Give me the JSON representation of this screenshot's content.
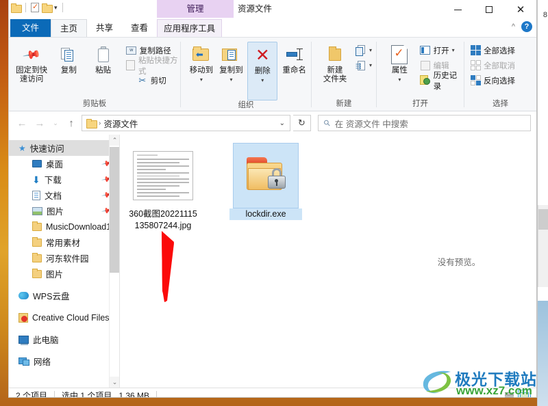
{
  "window": {
    "title": "资源文件",
    "contextual_tab_band": "管理",
    "quick_access": [
      {
        "name": "folder-icon",
        "label": "资源管理器"
      },
      {
        "name": "properties-icon",
        "label": "属性"
      },
      {
        "name": "new-folder-icon",
        "label": "新建文件夹"
      },
      {
        "name": "customize-caret",
        "label": "自定义快速访问工具栏"
      }
    ],
    "controls": {
      "minimize": "—",
      "maximize": "□",
      "close": "✕"
    },
    "ribbon_collapse": "^",
    "help": "?"
  },
  "tabs": [
    {
      "label": "文件",
      "state": "file"
    },
    {
      "label": "主页",
      "state": "active"
    },
    {
      "label": "共享",
      "state": "normal"
    },
    {
      "label": "查看",
      "state": "normal"
    },
    {
      "label": "应用程序工具",
      "state": "contextual"
    }
  ],
  "ribbon": {
    "groups": [
      {
        "label": "剪贴板",
        "big_buttons": [
          {
            "label": "固定到快\n速访问",
            "icon": "pin-icon"
          },
          {
            "label": "复制",
            "icon": "copy-icon"
          },
          {
            "label": "粘贴",
            "icon": "paste-icon"
          }
        ],
        "small_buttons": [
          {
            "label": "复制路径",
            "icon": "copy-path-icon",
            "disabled": false
          },
          {
            "label": "粘贴快捷方式",
            "icon": "paste-shortcut-icon",
            "disabled": true
          },
          {
            "label": "剪切",
            "icon": "cut-icon",
            "disabled": false
          }
        ]
      },
      {
        "label": "组织",
        "big_buttons": [
          {
            "label": "移动到",
            "icon": "move-to-icon",
            "has_caret": true
          },
          {
            "label": "复制到",
            "icon": "copy-to-icon",
            "has_caret": true
          },
          {
            "label": "删除",
            "icon": "delete-icon",
            "has_caret": true,
            "highlighted": true
          },
          {
            "label": "重命名",
            "icon": "rename-icon"
          }
        ]
      },
      {
        "label": "新建",
        "big_buttons": [
          {
            "label": "新建\n文件夹",
            "icon": "new-folder-icon"
          }
        ],
        "small_buttons": [
          {
            "label": "",
            "icon": "new-item-icon",
            "has_caret": true
          },
          {
            "label": "",
            "icon": "easy-access-icon",
            "has_caret": true
          }
        ]
      },
      {
        "label": "打开",
        "big_buttons": [
          {
            "label": "属性",
            "icon": "properties-icon",
            "has_caret": true
          }
        ],
        "small_buttons": [
          {
            "label": "打开",
            "icon": "open-icon",
            "has_caret": true,
            "disabled": false
          },
          {
            "label": "编辑",
            "icon": "edit-icon",
            "disabled": true
          },
          {
            "label": "历史记录",
            "icon": "history-icon",
            "disabled": false
          }
        ]
      },
      {
        "label": "选择",
        "small_buttons": [
          {
            "label": "全部选择",
            "icon": "select-all-icon"
          },
          {
            "label": "全部取消",
            "icon": "select-none-icon",
            "disabled": true
          },
          {
            "label": "反向选择",
            "icon": "invert-selection-icon"
          }
        ]
      }
    ]
  },
  "addressbar": {
    "back": "←",
    "forward": "→",
    "recent": "⌄",
    "up": "↑",
    "breadcrumb_icon": "folder-icon",
    "breadcrumb_separator": "›",
    "path": "资源文件",
    "dropdown": "⌄",
    "refresh": "↻"
  },
  "search": {
    "icon": "search-icon",
    "placeholder": "在 资源文件 中搜索"
  },
  "sidebar": {
    "items": [
      {
        "label": "快速访问",
        "icon": "quick-access-star-icon",
        "selected": true,
        "indent": false
      },
      {
        "label": "桌面",
        "icon": "desktop-icon",
        "indent": true,
        "pinned": true
      },
      {
        "label": "下载",
        "icon": "downloads-icon",
        "indent": true,
        "pinned": true
      },
      {
        "label": "文档",
        "icon": "documents-icon",
        "indent": true,
        "pinned": true
      },
      {
        "label": "图片",
        "icon": "pictures-icon",
        "indent": true,
        "pinned": true
      },
      {
        "label": "MusicDownload1",
        "icon": "folder-icon",
        "indent": true
      },
      {
        "label": "常用素材",
        "icon": "folder-icon",
        "indent": true
      },
      {
        "label": "河东软件园",
        "icon": "folder-icon",
        "indent": true
      },
      {
        "label": "图片",
        "icon": "folder-icon",
        "indent": true
      },
      {
        "label": "WPS云盘",
        "icon": "wps-cloud-icon",
        "indent": false,
        "gap_before": true
      },
      {
        "label": "Creative Cloud Files",
        "icon": "adobe-cc-icon",
        "indent": false,
        "gap_before": true
      },
      {
        "label": "此电脑",
        "icon": "this-pc-icon",
        "indent": false,
        "gap_before": true
      },
      {
        "label": "网络",
        "icon": "network-icon",
        "indent": false,
        "gap_before": true
      }
    ],
    "scroll": {
      "up": "⌃",
      "down": "⌄"
    }
  },
  "files": [
    {
      "name": "360截图20221115135807244.jpg",
      "display_name": "360截图20221115135807244.jpg",
      "type": "image-thumbnail",
      "selected": false
    },
    {
      "name": "lockdir.exe",
      "display_name": "lockdir.exe",
      "type": "locked-folder-icon",
      "selected": true
    }
  ],
  "preview": {
    "message": "没有预览。"
  },
  "status": {
    "item_count": "2 个项目",
    "selection": "选中 1 个项目",
    "size": "1.36 MB",
    "view_buttons": [
      {
        "name": "details-view-button",
        "active": false
      },
      {
        "name": "large-icons-view-button",
        "active": true
      }
    ]
  },
  "background_window": {
    "page_number": "8"
  },
  "watermark": {
    "line1": "极光下载站",
    "line2": "www.xz7.com"
  },
  "annotation": {
    "type": "red-arrow",
    "color": "#fb0a0a"
  },
  "colors": {
    "file_tab_blue": "#0b6ab8",
    "contextual_purple": "#e8d2f2",
    "selection_blue": "#cce4f7",
    "accent": "#1e78c8"
  }
}
